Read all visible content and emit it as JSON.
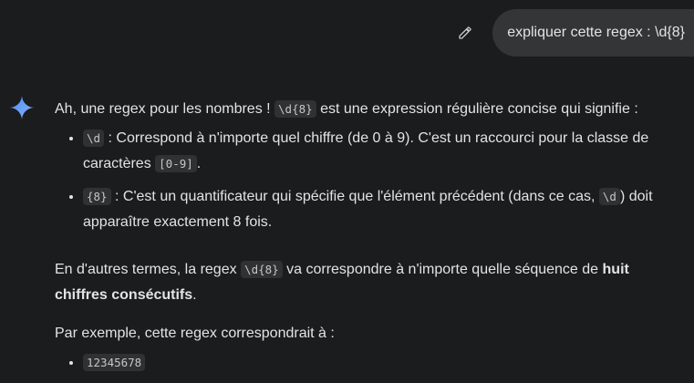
{
  "user": {
    "prompt": "expliquer cette regex : \\d{8}"
  },
  "response": {
    "intro_pre": "Ah, une regex pour les nombres ! ",
    "intro_code": "\\d{8}",
    "intro_post": " est une expression régulière concise qui signifie :",
    "bullets": [
      {
        "code": "\\d",
        "text_a": " : Correspond à n'importe quel chiffre (de 0 à 9). C'est un raccourci pour la classe de caractères ",
        "code2": "[0-9]",
        "text_b": "."
      },
      {
        "code": "{8}",
        "text_a": " : C'est un quantificateur qui spécifie que l'élément précédent (dans ce cas, ",
        "code2": "\\d",
        "text_b": ") doit apparaître exactement 8 fois."
      }
    ],
    "para2_pre": "En d'autres termes, la regex ",
    "para2_code": "\\d{8}",
    "para2_mid": " va correspondre à n'importe quelle séquence de ",
    "para2_bold": "huit chiffres consécutifs",
    "para2_post": ".",
    "para3": "Par exemple, cette regex correspondrait à :",
    "examples": [
      "12345678"
    ]
  },
  "icons": {
    "edit": "pencil-icon",
    "assistant": "gemini-sparkle-icon"
  },
  "colors": {
    "background": "#1b1c1d",
    "bubble": "#333537",
    "code_bg": "#303133",
    "sparkle_start": "#4a8cf7",
    "sparkle_end": "#8ab4f8"
  }
}
